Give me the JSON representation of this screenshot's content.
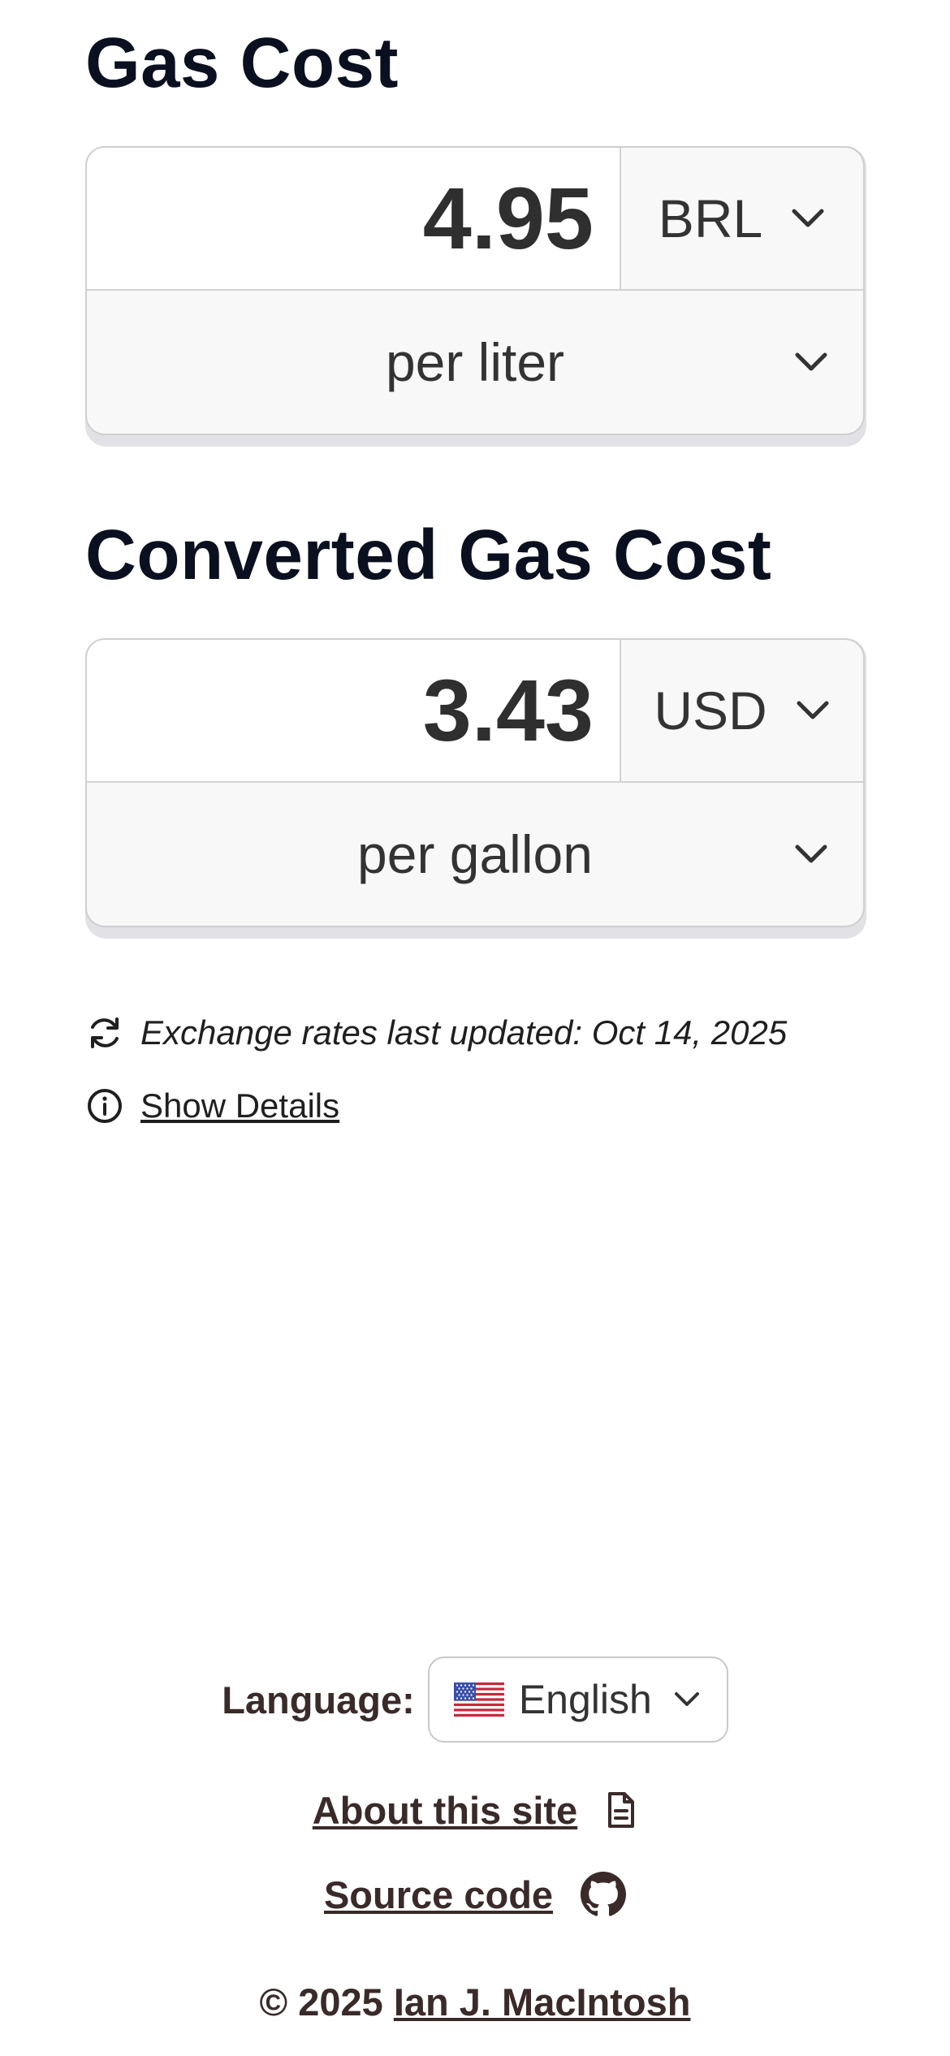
{
  "gas_cost": {
    "title": "Gas Cost",
    "amount": "4.95",
    "currency": "BRL",
    "unit": "per liter"
  },
  "converted": {
    "title": "Converted Gas Cost",
    "amount": "3.43",
    "currency": "USD",
    "unit": "per gallon"
  },
  "info": {
    "rates_updated": "Exchange rates last updated: Oct 14, 2025",
    "show_details": "Show Details",
    "refresh_icon": "refresh-icon",
    "info_icon": "info-icon"
  },
  "footer": {
    "language_label": "Language:",
    "language_value": "English",
    "about_label": "About this site",
    "source_label": "Source code",
    "copyright_prefix": "© 2025",
    "author": "Ian J. MacIntosh"
  },
  "colors": {
    "text_dark": "#0b1020",
    "footer_text": "#3a2a2a",
    "card_bg": "#f8f8f8",
    "card_border": "#cfcfd2"
  }
}
